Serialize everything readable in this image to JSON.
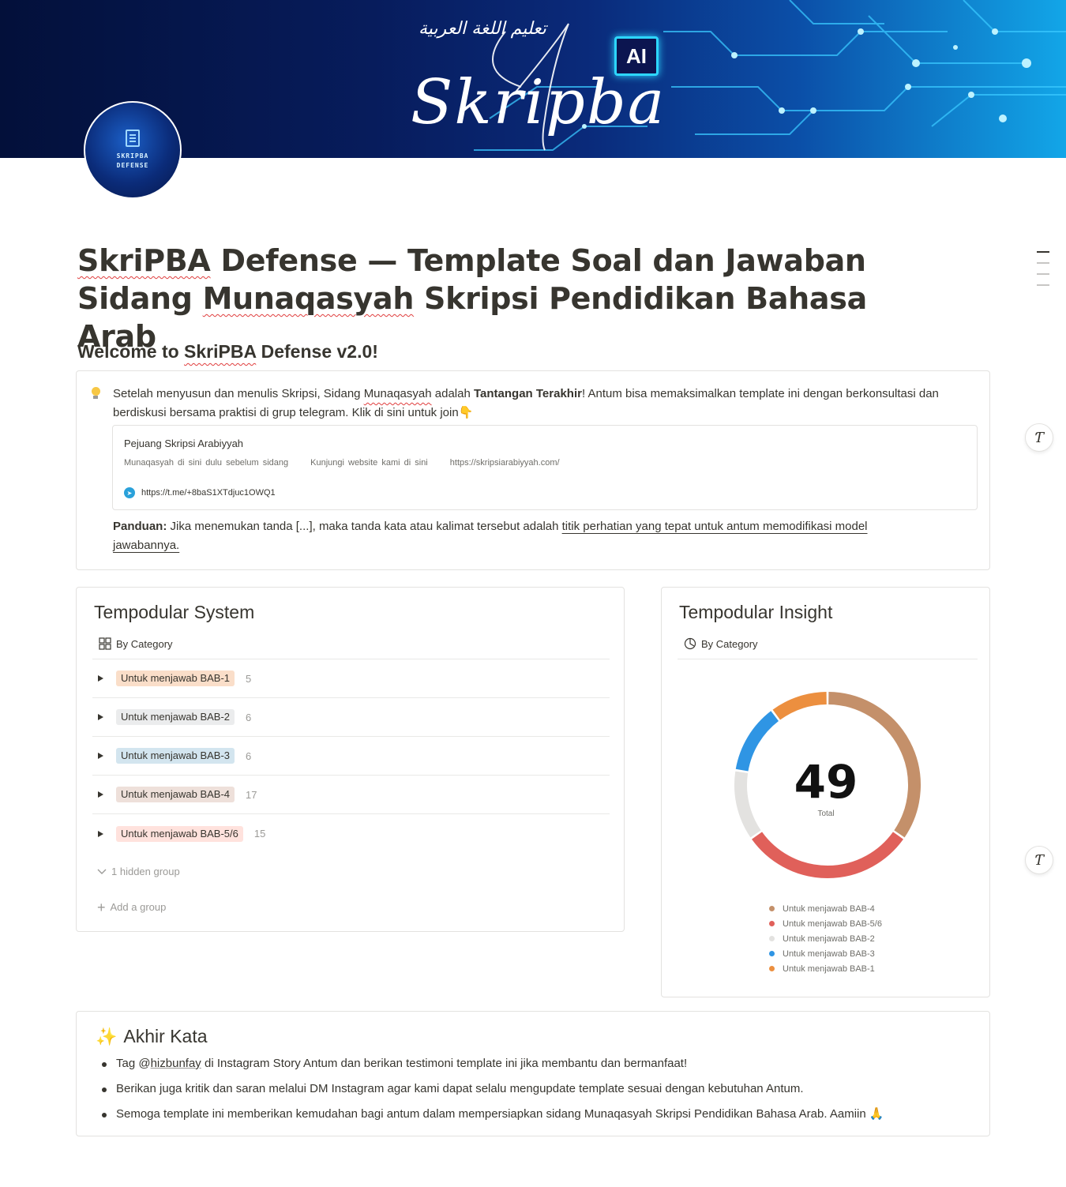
{
  "cover": {
    "arabic_text": "تعليم اللغة العربية",
    "logo_text": "Skripba",
    "ai_badge": "AI"
  },
  "avatar": {
    "line1": "SKRIPBA",
    "line2": "DEFENSE"
  },
  "page": {
    "title_part1": "SkriPBA",
    "title_part2": " Defense — Template Soal dan Jawaban Sidang ",
    "title_part3": "Munaqasyah",
    "title_part4": " Skripsi Pendidikan Bahasa Arab",
    "welcome_prefix": "Welcome to ",
    "welcome_brand": "SkriPBA",
    "welcome_suffix": " Defense v2.0!"
  },
  "callout": {
    "t1": "Setelah menyusun dan menulis Skripsi, Sidang ",
    "t2": "Munaqasyah",
    "t3": " adalah ",
    "t4": "Tantangan Terakhir",
    "t5": "! Antum bisa memaksimalkan template ini dengan berkonsultasi dan berdiskusi bersama praktisi di grup telegram. Klik di sini untuk join",
    "bookmark_title": "Pejuang Skripsi Arabiyyah",
    "bookmark_desc1": "Munaqasyah di sini dulu sebelum sidang",
    "bookmark_desc2": "Kunjungi website kami di sini",
    "bookmark_desc3": "https://skripsiarabiyyah.com/",
    "bookmark_url": "https://t.me/+8baS1XTdjuc1OWQ1",
    "guide_label": "Panduan:",
    "guide_text": " Jika menemukan tanda [...], maka tanda kata atau kalimat tersebut adalah ",
    "guide_link": "titik perhatian yang tepat untuk antum memodifikasi model jawabannya."
  },
  "system": {
    "title": "Tempodular System",
    "view": "By Category",
    "groups": [
      {
        "label": "Untuk menjawab BAB-1",
        "count": "5",
        "color": "#fadec9"
      },
      {
        "label": "Untuk menjawab BAB-2",
        "count": "6",
        "color": "#ebeced"
      },
      {
        "label": "Untuk menjawab BAB-3",
        "count": "6",
        "color": "#d3e5ef"
      },
      {
        "label": "Untuk menjawab BAB-4",
        "count": "17",
        "color": "#eee0da"
      },
      {
        "label": "Untuk menjawab BAB-5/6",
        "count": "15",
        "color": "#ffe2dd"
      }
    ],
    "hidden": "1 hidden group",
    "add": "Add a group"
  },
  "insight": {
    "title": "Tempodular Insight",
    "view": "By Category",
    "total": "49",
    "total_label": "Total"
  },
  "chart_data": {
    "type": "pie",
    "categories": [
      "Untuk menjawab BAB-4",
      "Untuk menjawab BAB-5/6",
      "Untuk menjawab BAB-2",
      "Untuk menjawab BAB-3",
      "Untuk menjawab BAB-1"
    ],
    "values": [
      17,
      15,
      6,
      6,
      5
    ],
    "colors": [
      "#c4906a",
      "#e0605a",
      "#e3e2e0",
      "#2f95e4",
      "#ec8f3f"
    ],
    "title": "",
    "legend": "bottom"
  },
  "akhir": {
    "title": "Akhir Kata",
    "item1_a": "Tag @",
    "item1_b": "hizbunfay",
    "item1_c": " di Instagram Story Antum dan berikan testimoni template ini jika membantu dan bermanfaat!",
    "item2": "Berikan juga kritik dan saran melalui DM Instagram agar kami dapat selalu mengupdate template sesuai dengan kebutuhan Antum.",
    "item3": "Semoga template ini memberikan kemudahan bagi antum dalam mempersiapkan sidang Munaqasyah Skripsi Pendidikan Bahasa Arab. Aamiin"
  }
}
